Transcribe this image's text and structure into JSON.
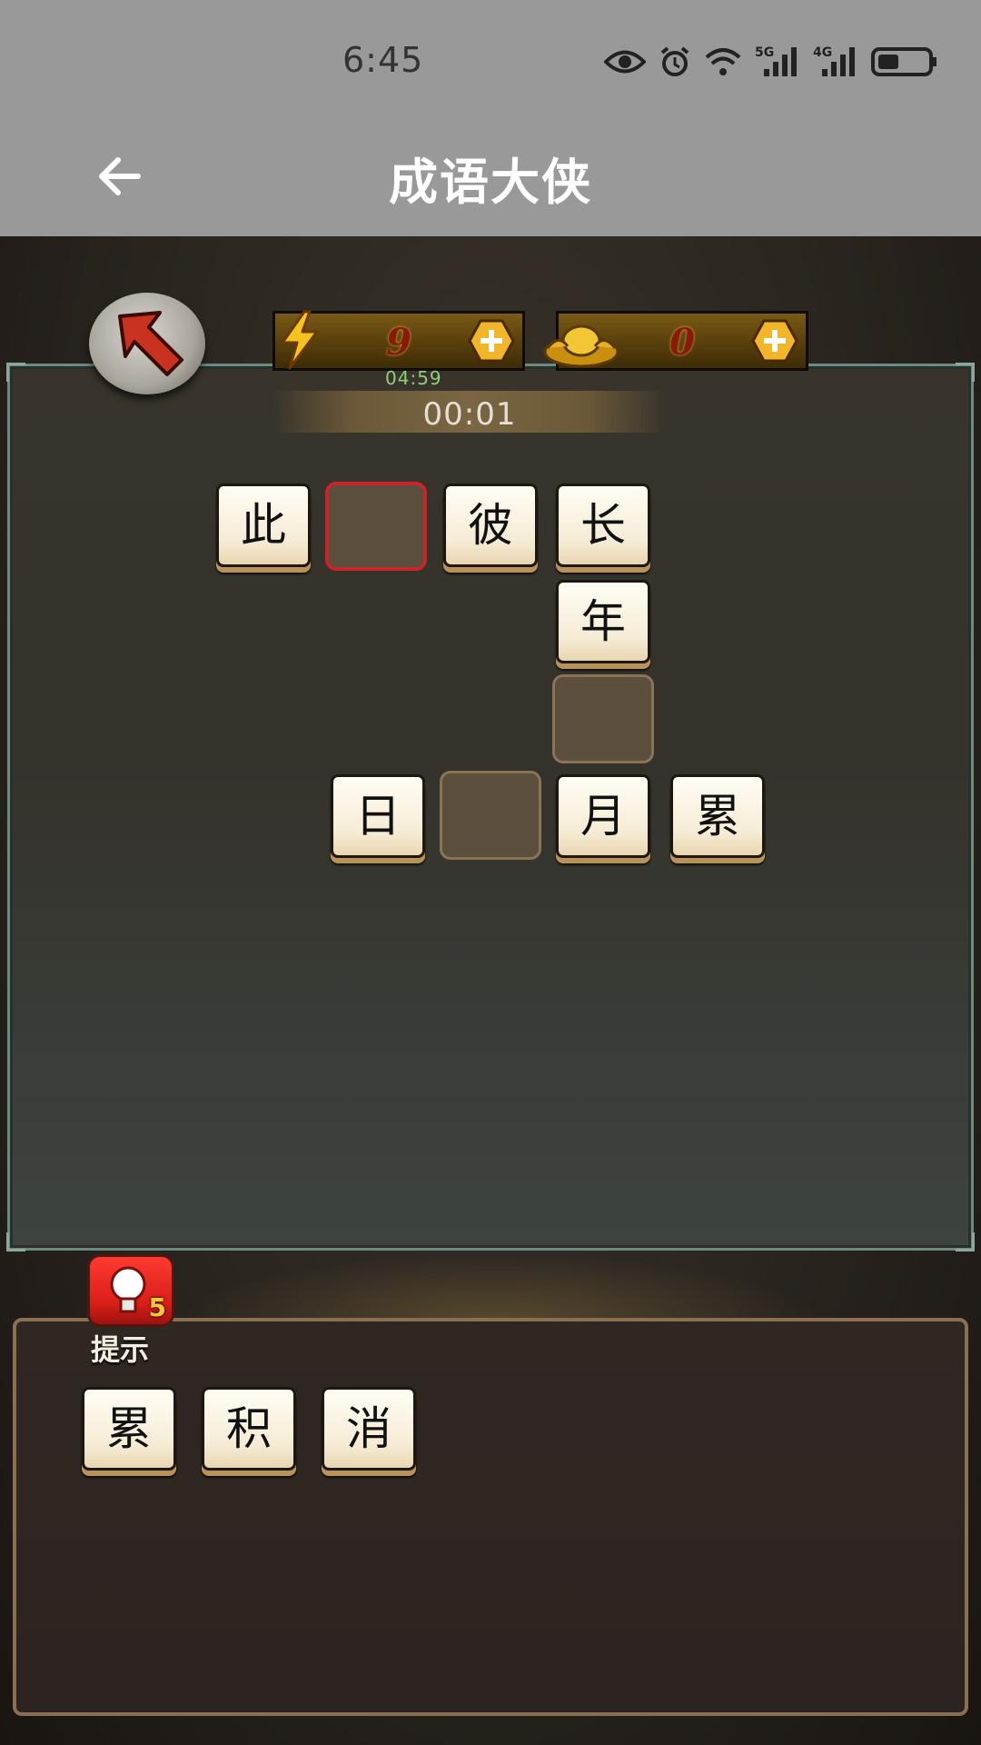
{
  "status_bar": {
    "time": "6:45",
    "signal_labels": [
      "5G",
      "4G"
    ]
  },
  "app_bar": {
    "title": "成语大侠"
  },
  "game": {
    "energy": {
      "value": "9"
    },
    "gold": {
      "value": "0"
    },
    "small_timer": "04:59",
    "timer": "00:01",
    "board_tiles": [
      {
        "char": "此"
      },
      {
        "char": ""
      },
      {
        "char": "彼"
      },
      {
        "char": "长"
      },
      {
        "char": "年"
      },
      {
        "char": ""
      },
      {
        "char": "日"
      },
      {
        "char": ""
      },
      {
        "char": "月"
      },
      {
        "char": "累"
      }
    ],
    "hint": {
      "label": "提示",
      "count": "5"
    },
    "choices": [
      "累",
      "积",
      "消"
    ]
  },
  "colors": {
    "bar_gray": "#999999",
    "active_slot_border": "#c8252a",
    "tile_face": "#f6ecd6",
    "board_border": "#6b8a80"
  }
}
